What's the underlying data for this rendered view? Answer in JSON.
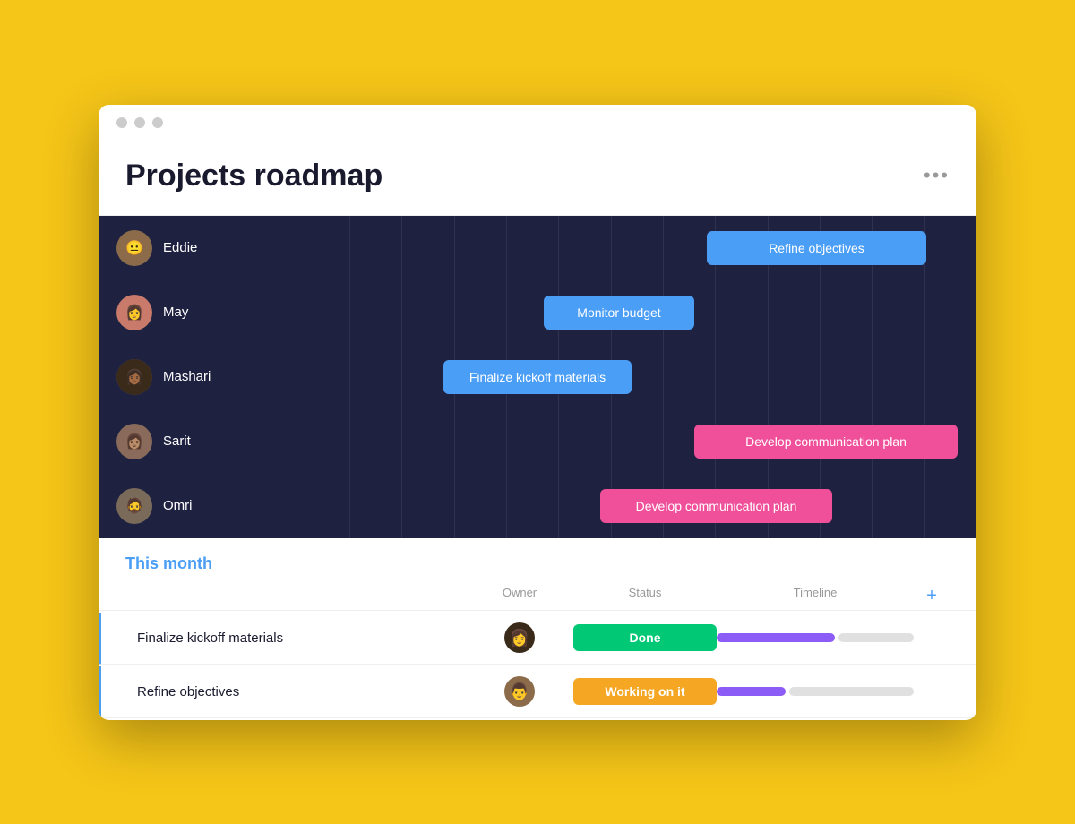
{
  "window": {
    "title": "Projects roadmap",
    "more_icon": "•••"
  },
  "gantt": {
    "people": [
      {
        "name": "Eddie",
        "avatar_class": "avatar-eddie",
        "avatar_emoji": "👨",
        "bar_label": "Refine objectives",
        "bar_color": "bar-blue",
        "bar_left": "57%",
        "bar_width": "35%"
      },
      {
        "name": "May",
        "avatar_class": "avatar-may",
        "avatar_emoji": "👩",
        "bar_label": "Monitor budget",
        "bar_color": "bar-blue",
        "bar_left": "31%",
        "bar_width": "24%"
      },
      {
        "name": "Mashari",
        "avatar_class": "avatar-mashari",
        "avatar_emoji": "👩",
        "bar_label": "Finalize kickoff materials",
        "bar_color": "bar-blue",
        "bar_left": "15%",
        "bar_width": "30%"
      },
      {
        "name": "Sarit",
        "avatar_class": "avatar-sarit",
        "avatar_emoji": "👩",
        "bar_label": "Develop communication plan",
        "bar_color": "bar-pink",
        "bar_left": "55%",
        "bar_width": "42%"
      },
      {
        "name": "Omri",
        "avatar_class": "avatar-omri",
        "avatar_emoji": "👨",
        "bar_label": "Develop communication plan",
        "bar_color": "bar-pink",
        "bar_left": "40%",
        "bar_width": "37%"
      }
    ]
  },
  "this_month": {
    "title": "This month",
    "columns": {
      "owner": "Owner",
      "status": "Status",
      "timeline": "Timeline"
    },
    "tasks": [
      {
        "name": "Finalize kickoff materials",
        "owner_emoji": "👩",
        "owner_bg": "#3A2A1A",
        "status_label": "Done",
        "status_class": "status-done",
        "progress": 60
      },
      {
        "name": "Refine objectives",
        "owner_emoji": "👨",
        "owner_bg": "#8B6B4A",
        "status_label": "Working on it",
        "status_class": "status-working",
        "progress": 35
      }
    ],
    "add_icon": "+"
  }
}
